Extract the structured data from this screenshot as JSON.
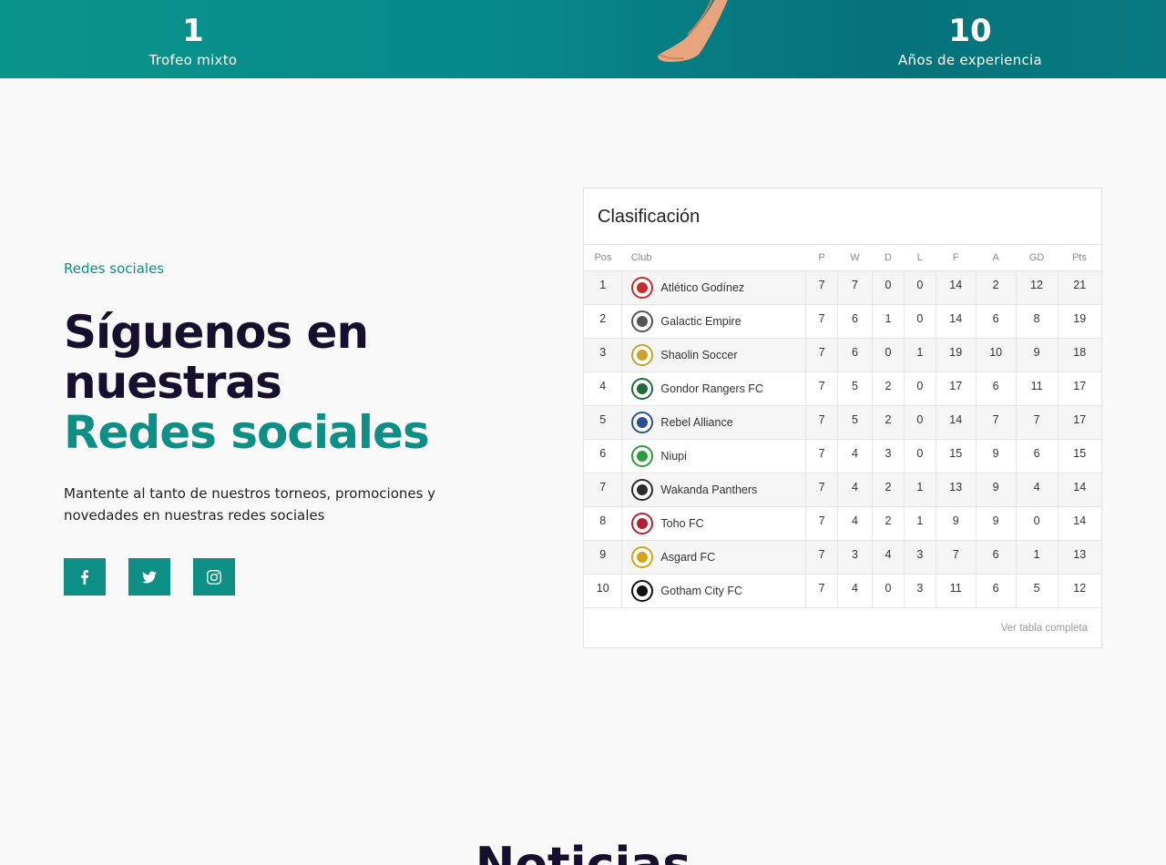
{
  "stats": [
    {
      "value": "1",
      "label": "Trofeo mixto"
    },
    {
      "value": "10",
      "label": "Años de experiencia"
    }
  ],
  "social": {
    "eyebrow": "Redes sociales",
    "title_line1": "Síguenos en",
    "title_line2": "nuestras",
    "title_accent": "Redes sociales",
    "description": "Mantente al tanto de nuestros torneos, promociones y novedades  en nuestras redes sociales",
    "icons": [
      "facebook-icon",
      "twitter-icon",
      "instagram-icon"
    ]
  },
  "standings": {
    "title": "Clasificación",
    "headers": {
      "pos": "Pos",
      "club": "Club",
      "p": "P",
      "w": "W",
      "d": "D",
      "l": "L",
      "f": "F",
      "a": "A",
      "gd": "GD",
      "pts": "Pts"
    },
    "rows": [
      {
        "pos": "1",
        "club": "Atlético Godínez",
        "p": "7",
        "w": "7",
        "d": "0",
        "l": "0",
        "f": "14",
        "a": "2",
        "gd": "12",
        "pts": "21",
        "crest_color": "#c62a2a"
      },
      {
        "pos": "2",
        "club": "Galactic Empire",
        "p": "7",
        "w": "6",
        "d": "1",
        "l": "0",
        "f": "14",
        "a": "6",
        "gd": "8",
        "pts": "19",
        "crest_color": "#555555"
      },
      {
        "pos": "3",
        "club": "Shaolin Soccer",
        "p": "7",
        "w": "6",
        "d": "0",
        "l": "1",
        "f": "19",
        "a": "10",
        "gd": "9",
        "pts": "18",
        "crest_color": "#c9a227"
      },
      {
        "pos": "4",
        "club": "Gondor Rangers FC",
        "p": "7",
        "w": "5",
        "d": "2",
        "l": "0",
        "f": "17",
        "a": "6",
        "gd": "11",
        "pts": "17",
        "crest_color": "#1e6b3a"
      },
      {
        "pos": "5",
        "club": "Rebel Alliance",
        "p": "7",
        "w": "5",
        "d": "2",
        "l": "0",
        "f": "14",
        "a": "7",
        "gd": "7",
        "pts": "17",
        "crest_color": "#2a4f9a"
      },
      {
        "pos": "6",
        "club": "Niupi",
        "p": "7",
        "w": "4",
        "d": "3",
        "l": "0",
        "f": "15",
        "a": "9",
        "gd": "6",
        "pts": "15",
        "crest_color": "#2e9b3c"
      },
      {
        "pos": "7",
        "club": "Wakanda Panthers",
        "p": "7",
        "w": "4",
        "d": "2",
        "l": "1",
        "f": "13",
        "a": "9",
        "gd": "4",
        "pts": "14",
        "crest_color": "#2b2b2b"
      },
      {
        "pos": "8",
        "club": "Toho FC",
        "p": "7",
        "w": "4",
        "d": "2",
        "l": "1",
        "f": "9",
        "a": "9",
        "gd": "0",
        "pts": "14",
        "crest_color": "#b3202f"
      },
      {
        "pos": "9",
        "club": "Asgard FC",
        "p": "7",
        "w": "3",
        "d": "4",
        "l": "3",
        "f": "7",
        "a": "6",
        "gd": "1",
        "pts": "13",
        "crest_color": "#d4a414"
      },
      {
        "pos": "10",
        "club": "Gotham City FC",
        "p": "7",
        "w": "4",
        "d": "0",
        "l": "3",
        "f": "11",
        "a": "6",
        "gd": "5",
        "pts": "12",
        "crest_color": "#111111"
      }
    ],
    "full_table_link": "Ver tabla completa"
  },
  "news": {
    "heading": "Noticias"
  },
  "colors": {
    "accent": "#0d8f86",
    "dark": "#170f2e"
  }
}
